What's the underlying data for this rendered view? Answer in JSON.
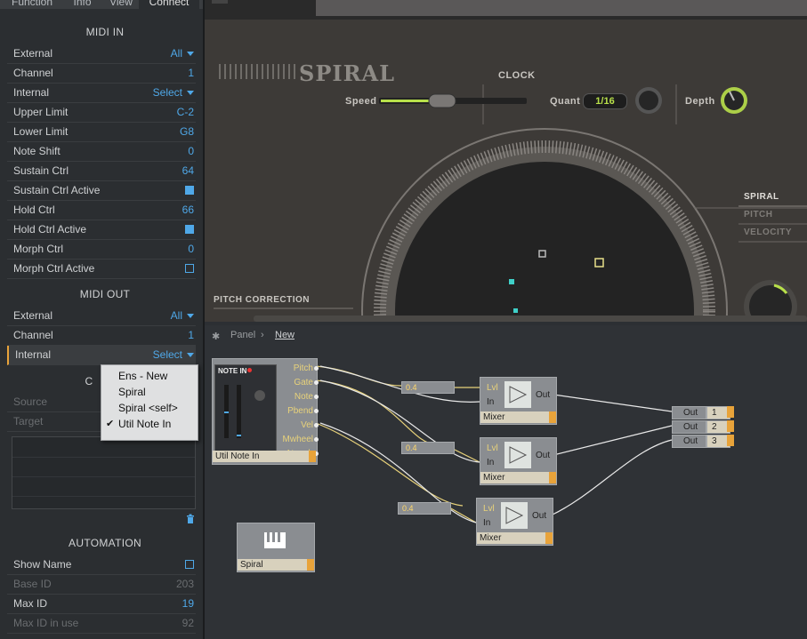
{
  "tabs": [
    "Function",
    "Info",
    "View",
    "Connect"
  ],
  "midi_in": {
    "title": "MIDI IN",
    "rows": [
      {
        "label": "External",
        "value": "All",
        "type": "dropdown"
      },
      {
        "label": "Channel",
        "value": "1",
        "type": "text"
      },
      {
        "label": "Internal",
        "value": "Select",
        "type": "dropdown"
      },
      {
        "label": "Upper Limit",
        "value": "C-2",
        "type": "text"
      },
      {
        "label": "Lower Limit",
        "value": "G8",
        "type": "text"
      },
      {
        "label": "Note Shift",
        "value": "0",
        "type": "text"
      },
      {
        "label": "Sustain Ctrl",
        "value": "64",
        "type": "text"
      },
      {
        "label": "Sustain Ctrl Active",
        "value": "",
        "type": "checked"
      },
      {
        "label": "Hold Ctrl",
        "value": "66",
        "type": "text"
      },
      {
        "label": "Hold Ctrl Active",
        "value": "",
        "type": "checked"
      },
      {
        "label": "Morph Ctrl",
        "value": "0",
        "type": "text"
      },
      {
        "label": "Morph Ctrl Active",
        "value": "",
        "type": "unchecked"
      }
    ]
  },
  "midi_out": {
    "title": "MIDI OUT",
    "rows": [
      {
        "label": "External",
        "value": "All",
        "type": "dropdown"
      },
      {
        "label": "Channel",
        "value": "1",
        "type": "text"
      },
      {
        "label": "Internal",
        "value": "Select",
        "type": "dropdown"
      }
    ]
  },
  "connections": {
    "title_visible": "C",
    "rows": [
      {
        "label": "Source"
      },
      {
        "label": "Target"
      }
    ]
  },
  "popup_menu": {
    "items": [
      {
        "label": "Ens - New",
        "checked": false
      },
      {
        "label": "Spiral",
        "checked": false
      },
      {
        "label": "Spiral <self>",
        "checked": false
      },
      {
        "label": "Util Note In",
        "checked": true
      }
    ],
    "check_glyph": "✔"
  },
  "automation": {
    "title": "AUTOMATION",
    "rows": [
      {
        "label": "Show Name",
        "value": "",
        "type": "unchecked"
      },
      {
        "label": "Base ID",
        "value": "203",
        "type": "dim"
      },
      {
        "label": "Max ID",
        "value": "19",
        "type": "text"
      },
      {
        "label": "Max ID in use",
        "value": "92",
        "type": "dim"
      }
    ]
  },
  "instrument": {
    "logo": "SPIRAL",
    "clock_label": "CLOCK",
    "speed_label": "Speed",
    "quant_label": "Quant",
    "quant_value": "1/16",
    "depth_label": "Depth",
    "pitch_correction_label": "PITCH CORRECTION",
    "modes": [
      "SPIRAL",
      "PITCH",
      "VELOCITY"
    ],
    "active_mode": "SPIRAL"
  },
  "breadcrumb": {
    "items": [
      "Panel",
      "New"
    ]
  },
  "note_in": {
    "title": "NOTE IN",
    "ports": [
      "Pitch",
      "Gate",
      "Note",
      "Pbend",
      "Vel",
      "Mwheel",
      "Atouch"
    ],
    "label": "Util Note In"
  },
  "spiral_module": {
    "label": "Spiral"
  },
  "mixers": [
    {
      "value": "0.4",
      "in_ports": [
        "Lvl",
        "In"
      ],
      "out_port": "Out",
      "label": "Mixer"
    },
    {
      "value": "0.4",
      "in_ports": [
        "Lvl",
        "In"
      ],
      "out_port": "Out",
      "label": "Mixer"
    },
    {
      "value": "0.4",
      "in_ports": [
        "Lvl",
        "In"
      ],
      "out_port": "Out",
      "label": "Mixer"
    }
  ],
  "outputs": [
    {
      "label": "Out",
      "num": "1"
    },
    {
      "label": "Out",
      "num": "2"
    },
    {
      "label": "Out",
      "num": "3"
    }
  ],
  "colors": {
    "accent_blue": "#4fa8e8",
    "accent_orange": "#e8a33a",
    "wire": "#e8d27a",
    "quant_green": "#b8e04a"
  }
}
